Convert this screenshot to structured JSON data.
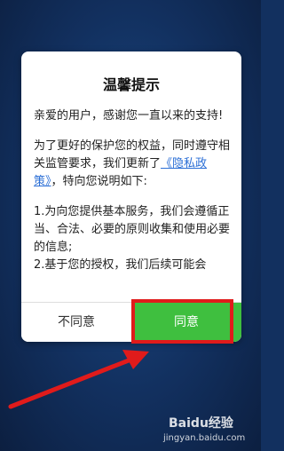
{
  "dialog": {
    "title": "温馨提示",
    "para1": "亲爱的用户，感谢您一直以来的支持!",
    "para2_prefix": "为了更好的保护您的权益，同时遵守相关监管要求，我们更新了",
    "para2_link": "《隐私政策》",
    "para2_suffix": "，特向您说明如下:",
    "item1": "1.为向您提供基本服务，我们会遵循正当、合法、必要的原则收集和使用必要的信息;",
    "item2": "2.基于您的授权，我们后续可能会",
    "decline_label": "不同意",
    "agree_label": "同意"
  },
  "watermark": {
    "brand": "Baidu经验",
    "url": "jingyan.baidu.com"
  },
  "colors": {
    "agree": "#3fbf3f",
    "highlight": "#e01b1b",
    "link": "#2b6fd6"
  }
}
